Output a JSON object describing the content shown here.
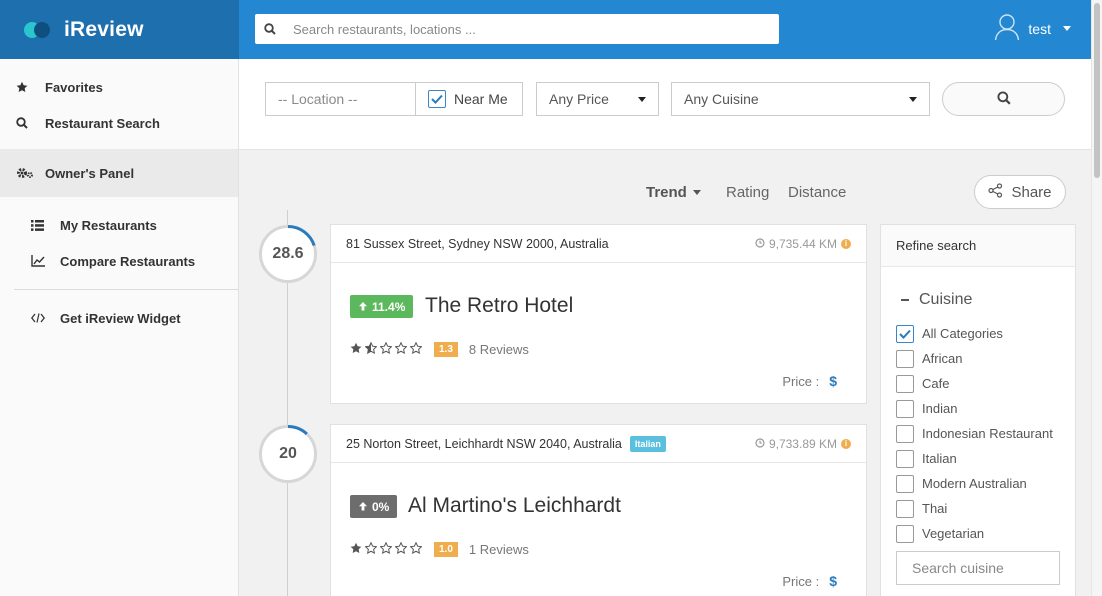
{
  "app": {
    "name": "iReview"
  },
  "header": {
    "search_placeholder": "Search restaurants, locations ...",
    "username": "test"
  },
  "sidebar": {
    "items": [
      {
        "label": "Favorites",
        "icon": "star-icon"
      },
      {
        "label": "Restaurant Search",
        "icon": "search-icon"
      },
      {
        "label": "Owner's Panel",
        "icon": "gears-icon",
        "active": true
      },
      {
        "label": "My Restaurants",
        "icon": "list-icon"
      },
      {
        "label": "Compare Restaurants",
        "icon": "line-chart-icon"
      },
      {
        "label": "Get iReview Widget",
        "icon": "code-icon"
      }
    ]
  },
  "filters": {
    "location_placeholder": "-- Location --",
    "near_me_label": "Near Me",
    "near_me_checked": true,
    "price_selected": "Any Price",
    "cuisine_selected": "Any Cuisine"
  },
  "sort": {
    "options": [
      "Trend",
      "Rating",
      "Distance"
    ],
    "active": "Trend",
    "share_label": "Share"
  },
  "restaurants": [
    {
      "score": "28.6",
      "score_fraction": 0.2,
      "address": "81 Sussex Street, Sydney NSW 2000, Australia",
      "tag": "",
      "distance": "9,735.44 KM",
      "trend": "11.4%",
      "trend_color": "#5cb85c",
      "name": "The Retro Hotel",
      "stars": 1.5,
      "rating": "1.3",
      "reviews": "8 Reviews",
      "price_label": "Price :",
      "price": "$"
    },
    {
      "score": "20",
      "score_fraction": 0.12,
      "address": "25 Norton Street, Leichhardt NSW 2040, Australia",
      "tag": "Italian",
      "distance": "9,733.89 KM",
      "trend": "0%",
      "trend_color": "#6d6d6d",
      "name": "Al Martino's Leichhardt",
      "stars": 1,
      "rating": "1.0",
      "reviews": "1 Reviews",
      "price_label": "Price :",
      "price": "$"
    }
  ],
  "refine": {
    "title": "Refine search",
    "cuisine_title": "Cuisine",
    "categories": [
      {
        "label": "All Categories",
        "checked": true
      },
      {
        "label": "African",
        "checked": false
      },
      {
        "label": "Cafe",
        "checked": false
      },
      {
        "label": "Indian",
        "checked": false
      },
      {
        "label": "Indonesian Restaurant",
        "checked": false
      },
      {
        "label": "Italian",
        "checked": false
      },
      {
        "label": "Modern Australian",
        "checked": false
      },
      {
        "label": "Thai",
        "checked": false
      },
      {
        "label": "Vegetarian",
        "checked": false
      }
    ],
    "search_placeholder": "Search cuisine"
  },
  "colors": {
    "brand_dark": "#1d6fae",
    "brand": "#2387d1",
    "accent": "#2a7bbd",
    "rating_badge": "#f0ad4e",
    "tag": "#5bc0de"
  }
}
